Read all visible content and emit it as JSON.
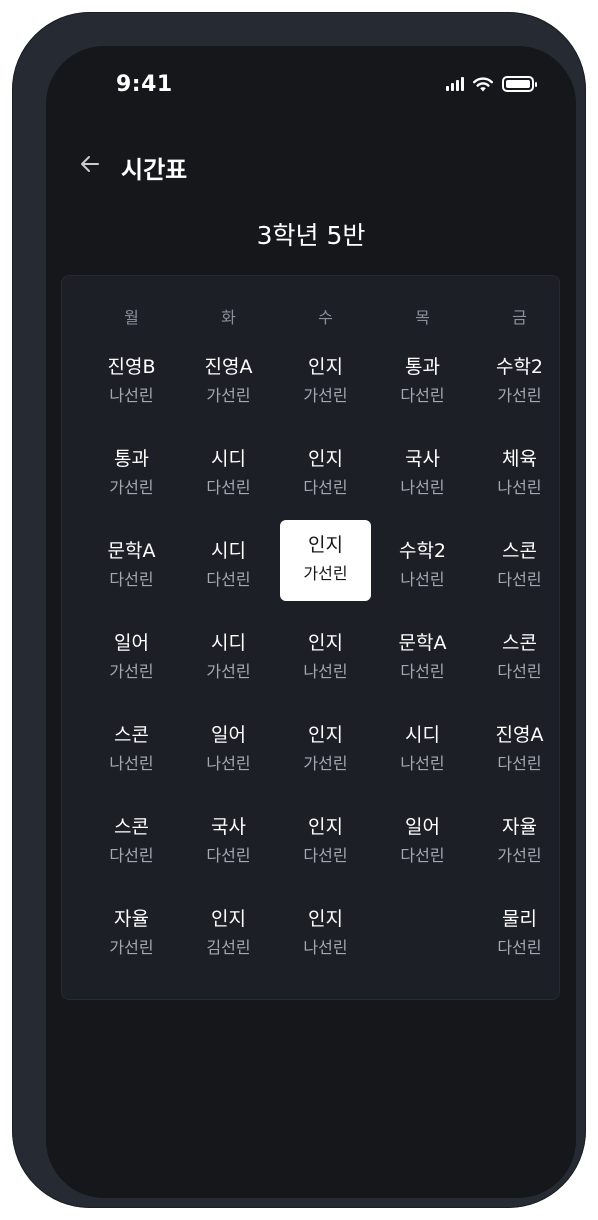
{
  "status_bar": {
    "time": "9:41"
  },
  "header": {
    "title": "시간표",
    "back_icon": "arrow-left-icon"
  },
  "class_title": "3학년 5반",
  "days": [
    "월",
    "화",
    "수",
    "목",
    "금"
  ],
  "timetable": [
    [
      {
        "subject": "진영B",
        "teacher": "나선린"
      },
      {
        "subject": "진영A",
        "teacher": "가선린"
      },
      {
        "subject": "인지",
        "teacher": "가선린"
      },
      {
        "subject": "통과",
        "teacher": "다선린"
      },
      {
        "subject": "수학2",
        "teacher": "가선린"
      }
    ],
    [
      {
        "subject": "통과",
        "teacher": "가선린"
      },
      {
        "subject": "시디",
        "teacher": "다선린"
      },
      {
        "subject": "인지",
        "teacher": "다선린"
      },
      {
        "subject": "국사",
        "teacher": "나선린"
      },
      {
        "subject": "체육",
        "teacher": "나선린"
      }
    ],
    [
      {
        "subject": "문학A",
        "teacher": "다선린"
      },
      {
        "subject": "시디",
        "teacher": "다선린"
      },
      {
        "subject": "인지",
        "teacher": "가선린",
        "selected": true
      },
      {
        "subject": "수학2",
        "teacher": "나선린"
      },
      {
        "subject": "스콘",
        "teacher": "다선린"
      }
    ],
    [
      {
        "subject": "일어",
        "teacher": "가선린"
      },
      {
        "subject": "시디",
        "teacher": "가선린"
      },
      {
        "subject": "인지",
        "teacher": "나선린"
      },
      {
        "subject": "문학A",
        "teacher": "다선린"
      },
      {
        "subject": "스콘",
        "teacher": "다선린"
      }
    ],
    [
      {
        "subject": "스콘",
        "teacher": "나선린"
      },
      {
        "subject": "일어",
        "teacher": "나선린"
      },
      {
        "subject": "인지",
        "teacher": "가선린"
      },
      {
        "subject": "시디",
        "teacher": "나선린"
      },
      {
        "subject": "진영A",
        "teacher": "다선린"
      }
    ],
    [
      {
        "subject": "스콘",
        "teacher": "다선린"
      },
      {
        "subject": "국사",
        "teacher": "다선린"
      },
      {
        "subject": "인지",
        "teacher": "다선린"
      },
      {
        "subject": "일어",
        "teacher": "다선린"
      },
      {
        "subject": "자율",
        "teacher": "가선린"
      }
    ],
    [
      {
        "subject": "자율",
        "teacher": "가선린"
      },
      {
        "subject": "인지",
        "teacher": "김선린"
      },
      {
        "subject": "인지",
        "teacher": "나선린"
      },
      {
        "subject": "",
        "teacher": ""
      },
      {
        "subject": "물리",
        "teacher": "다선린"
      }
    ]
  ],
  "colors": {
    "background": "#15171b",
    "card": "#1c1f25",
    "selected": "#ffffff",
    "frame": "#262a33"
  }
}
